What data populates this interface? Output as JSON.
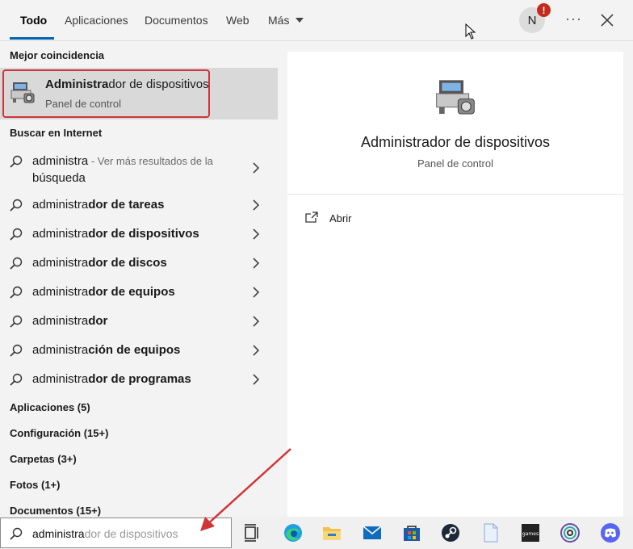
{
  "tabs": [
    {
      "label": "Todo",
      "active": true
    },
    {
      "label": "Aplicaciones"
    },
    {
      "label": "Documentos"
    },
    {
      "label": "Web"
    },
    {
      "label": "Más"
    }
  ],
  "account": {
    "initial": "N",
    "badge": "!"
  },
  "more_label": "···",
  "best_match": {
    "section_label": "Mejor coincidencia",
    "title_match": "Administra",
    "title_rest": "dor de dispositivos",
    "subtitle": "Panel de control"
  },
  "web_section_label": "Buscar en Internet",
  "suggestions": [
    {
      "prefix": "administra",
      "rest": "",
      "hint": " - Ver más resultados de la",
      "hint2": "búsqueda"
    },
    {
      "prefix": "administra",
      "rest": "dor de tareas"
    },
    {
      "prefix": "administra",
      "rest": "dor de dispositivos"
    },
    {
      "prefix": "administra",
      "rest": "dor de discos"
    },
    {
      "prefix": "administra",
      "rest": "dor de equipos"
    },
    {
      "prefix": "administra",
      "rest": "dor"
    },
    {
      "prefix": "administra",
      "rest": "ción de equipos"
    },
    {
      "prefix": "administra",
      "rest": "dor de programas"
    }
  ],
  "categories": [
    "Aplicaciones (5)",
    "Configuración (15+)",
    "Carpetas (3+)",
    "Fotos (1+)",
    "Documentos (15+)"
  ],
  "preview": {
    "title": "Administrador de dispositivos",
    "subtitle": "Panel de control",
    "open_label": "Abrir"
  },
  "search": {
    "typed": "administra",
    "ghost": "dor de dispositivos"
  },
  "taskbar_icons": [
    "task-view-icon",
    "edge-icon",
    "file-explorer-icon",
    "mail-icon",
    "store-icon",
    "steam-icon",
    "notepad-icon",
    "games-icon",
    "app-spiral-icon",
    "discord-icon"
  ],
  "colors": {
    "accent": "#0063b1",
    "highlight_frame": "#d13438",
    "arrow": "#d13438"
  }
}
